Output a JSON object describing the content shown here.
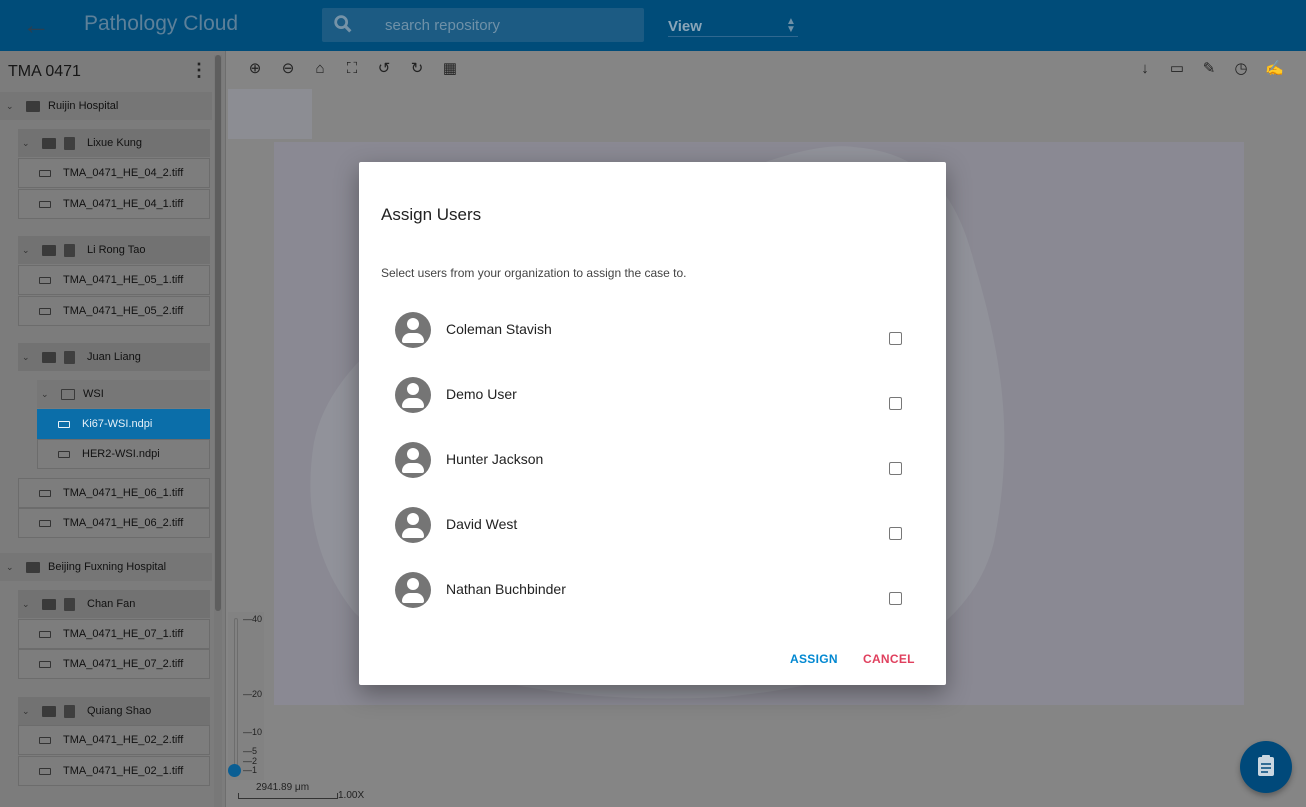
{
  "header": {
    "title": "Pathology Cloud",
    "search_placeholder": "search repository",
    "view_label": "View"
  },
  "sidebar": {
    "case_title": "TMA 0471",
    "rows": [
      {
        "type": "hosp",
        "label": "Ruijin Hospital"
      },
      {
        "type": "case",
        "label": "Lixue Kung"
      },
      {
        "type": "file",
        "label": "TMA_0471_HE_04_2.tiff"
      },
      {
        "type": "file",
        "label": "TMA_0471_HE_04_1.tiff"
      },
      {
        "type": "case",
        "label": "Li Rong Tao"
      },
      {
        "type": "file",
        "label": "TMA_0471_HE_05_1.tiff"
      },
      {
        "type": "file",
        "label": "TMA_0471_HE_05_2.tiff"
      },
      {
        "type": "case",
        "label": "Juan Liang"
      },
      {
        "type": "folder",
        "label": "WSI"
      },
      {
        "type": "file",
        "label": "Ki67-WSI.ndpi",
        "selected": true
      },
      {
        "type": "file",
        "label": "HER2-WSI.ndpi"
      },
      {
        "type": "file",
        "label": "TMA_0471_HE_06_1.tiff"
      },
      {
        "type": "file",
        "label": "TMA_0471_HE_06_2.tiff"
      },
      {
        "type": "hosp",
        "label": "Beijing Fuxning Hospital"
      },
      {
        "type": "case",
        "label": "Chan Fan"
      },
      {
        "type": "file",
        "label": "TMA_0471_HE_07_1.tiff"
      },
      {
        "type": "file",
        "label": "TMA_0471_HE_07_2.tiff"
      },
      {
        "type": "case",
        "label": "Quiang Shao"
      },
      {
        "type": "file",
        "label": "TMA_0471_HE_02_2.tiff"
      },
      {
        "type": "file",
        "label": "TMA_0471_HE_02_1.tiff"
      }
    ]
  },
  "viewer": {
    "zoom_ticks": [
      "40",
      "20",
      "10",
      "5",
      "2",
      "1"
    ],
    "zoom_value": 1,
    "scale_label": "2941.89 μm",
    "zoom_level": "1.00X"
  },
  "modal": {
    "title": "Assign Users",
    "subtitle": "Select users from your organization to assign the case to.",
    "users": [
      {
        "name": "Coleman Stavish",
        "checked": false
      },
      {
        "name": "Demo User",
        "checked": false
      },
      {
        "name": "Hunter Jackson",
        "checked": false
      },
      {
        "name": "David West",
        "checked": false
      },
      {
        "name": "Nathan Buchbinder",
        "checked": false
      }
    ],
    "assign_label": "ASSIGN",
    "cancel_label": "CANCEL"
  },
  "colors": {
    "header": "#004c79",
    "selected": "#0b6ea9",
    "assign": "#0288d1",
    "cancel": "#e0405e"
  }
}
